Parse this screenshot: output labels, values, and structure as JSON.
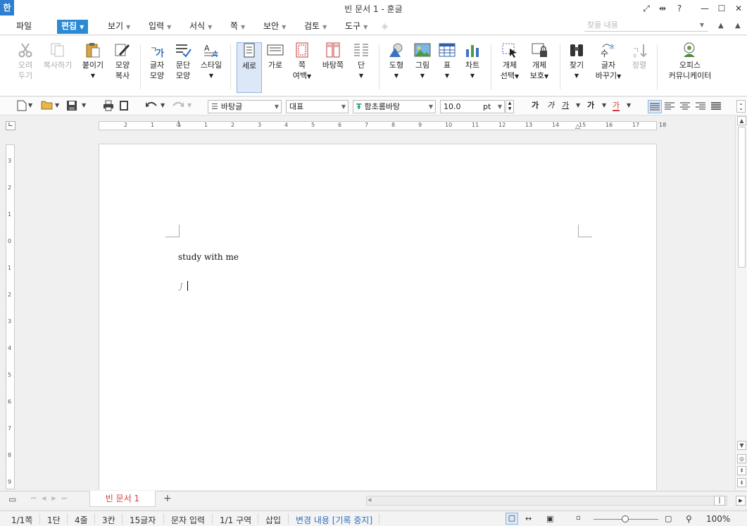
{
  "app": {
    "logo": "한",
    "title": "빈 문서 1 - 훈글"
  },
  "window_buttons": [
    {
      "name": "fullscreen-icon",
      "glyph": "⤢"
    },
    {
      "name": "split-icon",
      "glyph": "⇹"
    },
    {
      "name": "help-icon",
      "glyph": "?"
    },
    {
      "name": "minimize-icon",
      "glyph": "—"
    },
    {
      "name": "maximize-icon",
      "glyph": "☐"
    },
    {
      "name": "close-icon",
      "glyph": "✕"
    }
  ],
  "menu": {
    "file": "파일",
    "edit": "편집",
    "view": "보기",
    "input": "입력",
    "format": "서식",
    "page": "쪽",
    "security": "보안",
    "review": "검토",
    "tools": "도구"
  },
  "find": {
    "placeholder": "찾을 내용"
  },
  "ribbon": {
    "cut": [
      "오려",
      "두기"
    ],
    "copy": "복사하기",
    "paste": "붙이기",
    "format_copy": [
      "모양",
      "복사"
    ],
    "char_shape": [
      "글자",
      "모양"
    ],
    "para_shape": [
      "문단",
      "모양"
    ],
    "style": "스타일",
    "portrait": "세로",
    "landscape": "가로",
    "page_margin": [
      "쪽",
      "여백"
    ],
    "background": "바탕쪽",
    "column": "단",
    "shape": "도형",
    "picture": "그림",
    "table": "표",
    "chart": "차트",
    "obj_select": [
      "개체",
      "선택"
    ],
    "obj_protect": [
      "개체",
      "보호"
    ],
    "find": "찾기",
    "replace": [
      "글자",
      "바꾸기"
    ],
    "sort": "정렬",
    "office": [
      "오피스",
      "커뮤니케이터"
    ]
  },
  "format_bar": {
    "style": "바탕글",
    "lang": "대표",
    "font": "함초롬바탕",
    "size": "10.0",
    "unit": "pt",
    "bold": "가",
    "italic": "가",
    "underline": "가",
    "strike": "가",
    "color": "가"
  },
  "ruler": {
    "h_ticks": [
      "2",
      "1",
      "1",
      "1",
      "2",
      "3",
      "4",
      "5",
      "6",
      "7",
      "8",
      "9",
      "10",
      "11",
      "12",
      "13",
      "14",
      "15",
      "16",
      "17",
      "18"
    ],
    "v_ticks": [
      "3",
      "2",
      "1",
      "0",
      "1",
      "2",
      "3",
      "4",
      "5",
      "6",
      "7",
      "8",
      "9"
    ]
  },
  "document": {
    "text": "study with me"
  },
  "tabs": {
    "doc_tab": "빈 문서 1",
    "add": "+"
  },
  "status": {
    "page": "1/1쪽",
    "column": "1단",
    "line": "4줄",
    "col": "3칸",
    "chars": "15글자",
    "mode": "문자 입력",
    "section": "1/1 구역",
    "insert": "삽입",
    "track": "변경 내용 [기록 중지]",
    "zoom": "100%"
  },
  "colors": {
    "accent": "#2a8ad4",
    "tab_text": "#d23b3b",
    "selected_bg": "#dce8f8"
  }
}
